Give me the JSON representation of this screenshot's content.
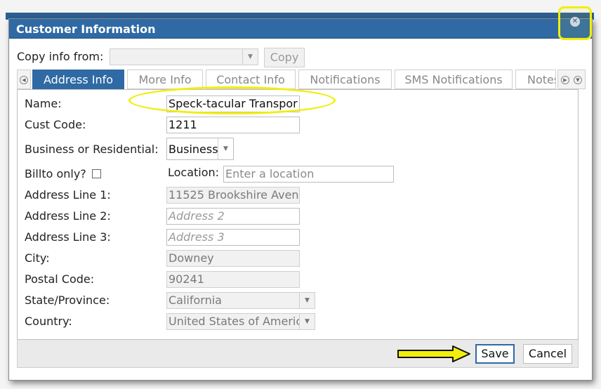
{
  "dialog": {
    "title": "Customer Information",
    "close_icon": "close-icon"
  },
  "copy": {
    "label": "Copy info from:",
    "selected": "",
    "button": "Copy"
  },
  "tabs": [
    {
      "label": "Address Info",
      "active": true
    },
    {
      "label": "More Info",
      "active": false
    },
    {
      "label": "Contact Info",
      "active": false
    },
    {
      "label": "Notifications",
      "active": false
    },
    {
      "label": "SMS Notifications",
      "active": false
    },
    {
      "label": "Notes",
      "active": false
    }
  ],
  "form": {
    "name_label": "Name:",
    "name_value": "Speck-tacular Transpor",
    "cust_code_label": "Cust Code:",
    "cust_code_value": "1211",
    "bus_res_label": "Business or Residential:",
    "bus_res_value": "Business",
    "billto_label": "Billto only?",
    "location_label": "Location:",
    "location_placeholder": "Enter a location",
    "address1_label": "Address Line 1:",
    "address1_value": "11525 Brookshire Aven",
    "address2_label": "Address Line 2:",
    "address2_placeholder": "Address 2",
    "address3_label": "Address Line 3:",
    "address3_placeholder": "Address 3",
    "city_label": "City:",
    "city_value": "Downey",
    "postal_label": "Postal Code:",
    "postal_value": "90241",
    "state_label": "State/Province:",
    "state_value": "California",
    "country_label": "Country:",
    "country_value": "United States of Americ"
  },
  "footer": {
    "save": "Save",
    "cancel": "Cancel"
  },
  "colors": {
    "accent": "#2f6aa4",
    "highlight": "#f2ee0c"
  }
}
